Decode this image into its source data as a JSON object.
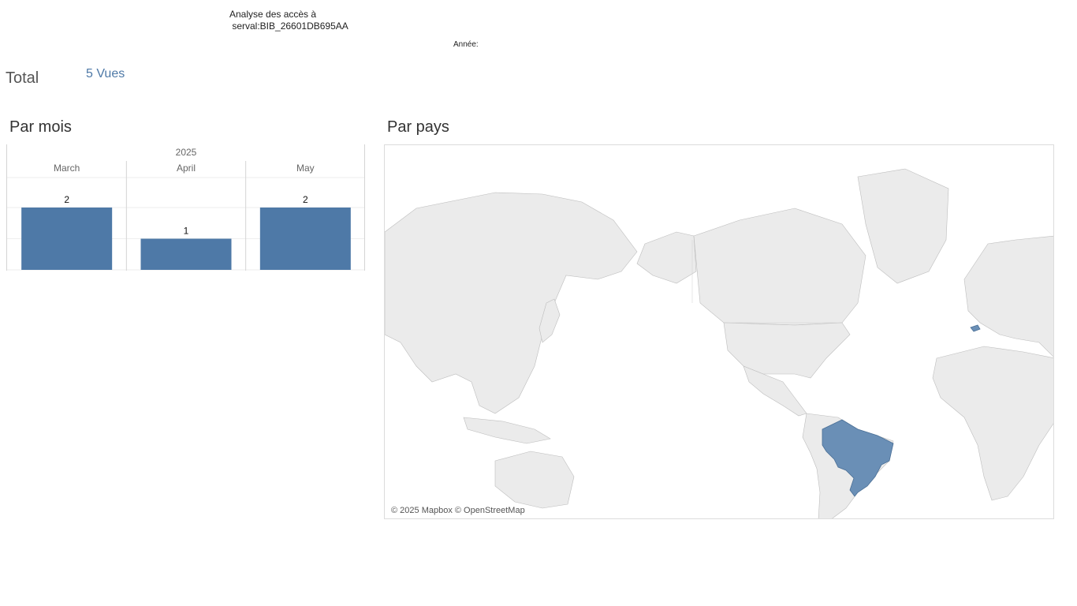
{
  "header": {
    "title": "Analyse des accès à\n serval:BIB_26601DB695AA",
    "year_label": "Année:"
  },
  "total": {
    "label": "Total",
    "value": "5 Vues"
  },
  "by_month": {
    "title": "Par mois"
  },
  "by_country": {
    "title": "Par pays",
    "credit": "© 2025 Mapbox © OpenStreetMap",
    "highlighted_countries": [
      "Brazil",
      "Switzerland"
    ],
    "highlight_color": "#6a8fb6"
  },
  "chart_data": {
    "type": "bar",
    "title": "",
    "group_label": "2025",
    "categories": [
      "March",
      "April",
      "May"
    ],
    "values": [
      2,
      1,
      2
    ],
    "xlabel": "",
    "ylabel": "",
    "ylim": [
      0,
      2
    ],
    "bar_color": "#4e79a7",
    "grid": true
  }
}
